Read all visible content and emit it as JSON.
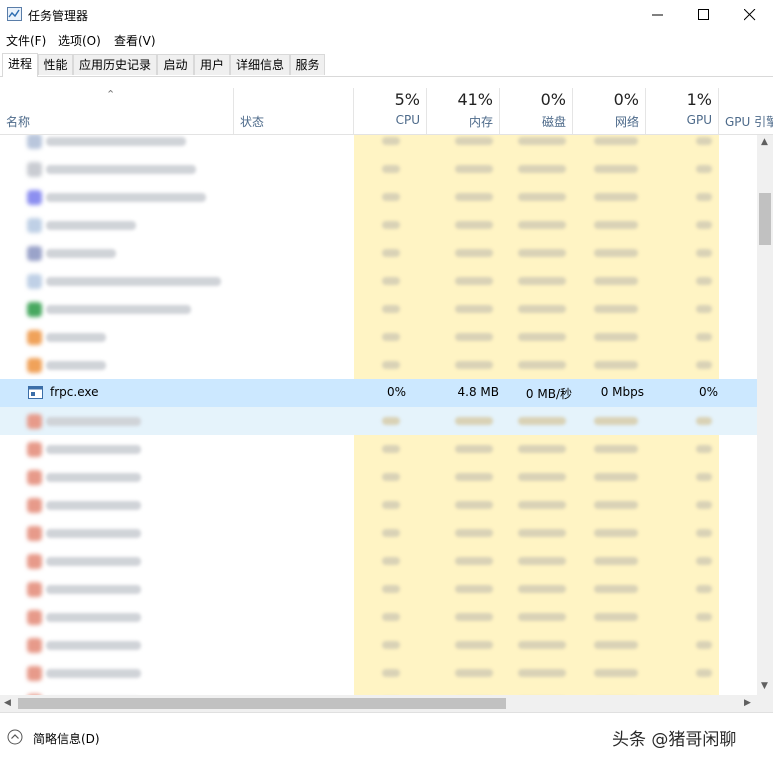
{
  "window": {
    "title": "任务管理器",
    "icon": "task-manager-icon"
  },
  "menu": [
    "文件(F)",
    "选项(O)",
    "查看(V)"
  ],
  "tabs": [
    "进程",
    "性能",
    "应用历史记录",
    "启动",
    "用户",
    "详细信息",
    "服务"
  ],
  "active_tab": "进程",
  "columns": {
    "name": {
      "label": "名称"
    },
    "status": {
      "label": "状态"
    },
    "cpu": {
      "pct": "5%",
      "label": "CPU"
    },
    "memory": {
      "pct": "41%",
      "label": "内存"
    },
    "disk": {
      "pct": "0%",
      "label": "磁盘"
    },
    "network": {
      "pct": "0%",
      "label": "网络"
    },
    "gpu": {
      "pct": "1%",
      "label": "GPU"
    },
    "gpu_engine": {
      "label": "GPU 引擎"
    }
  },
  "selected_process": {
    "name": "frpc.exe",
    "cpu": "0%",
    "memory": "4.8 MB",
    "disk": "0 MB/秒",
    "network": "0 Mbps",
    "gpu": "0%"
  },
  "footer": {
    "fewer_details": "简略信息(D)",
    "watermark": "头条 @猪哥闲聊"
  },
  "colors": {
    "selected_row": "#cce8ff",
    "usage_highlight": "#fff4c4",
    "header_label": "#4d6a8a"
  }
}
